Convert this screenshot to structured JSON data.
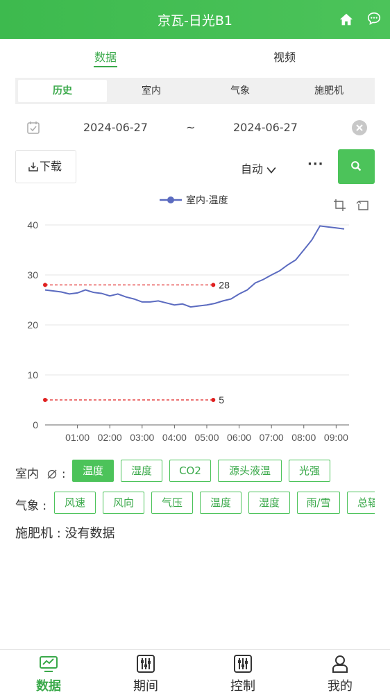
{
  "header": {
    "title": "京瓦-日光B1"
  },
  "top_tabs": [
    {
      "label": "数据",
      "active": true
    },
    {
      "label": "视频",
      "active": false
    }
  ],
  "sub_tabs": [
    {
      "label": "历史",
      "active": true
    },
    {
      "label": "室内"
    },
    {
      "label": "气象"
    },
    {
      "label": "施肥机"
    }
  ],
  "date_range": {
    "start": "2024-06-27",
    "separator": "~",
    "end": "2024-06-27"
  },
  "toolbar": {
    "download_label": "下载",
    "mode_label": "自动",
    "more_label": "···"
  },
  "chart_data": {
    "type": "line",
    "series": [
      {
        "name": "室内-温度",
        "color": "#5b6bc0"
      }
    ],
    "x_ticks": [
      "01:00",
      "02:00",
      "03:00",
      "04:00",
      "05:00",
      "06:00",
      "07:00",
      "08:00",
      "09:00"
    ],
    "y_ticks": [
      0,
      10,
      20,
      30,
      40
    ],
    "ylim": [
      0,
      40
    ],
    "xlim_hours": [
      0,
      9.4
    ],
    "x": [
      0.0,
      0.25,
      0.5,
      0.75,
      1.0,
      1.25,
      1.5,
      1.75,
      2.0,
      2.25,
      2.5,
      2.75,
      3.0,
      3.25,
      3.5,
      3.75,
      4.0,
      4.25,
      4.5,
      4.75,
      5.0,
      5.25,
      5.5,
      5.75,
      6.0,
      6.25,
      6.5,
      6.75,
      7.0,
      7.25,
      7.5,
      7.75,
      8.0,
      8.25,
      8.5,
      8.75,
      9.0,
      9.25
    ],
    "y": [
      27.0,
      26.8,
      26.6,
      26.2,
      26.4,
      27.0,
      26.5,
      26.3,
      25.8,
      26.2,
      25.6,
      25.2,
      24.6,
      24.6,
      24.8,
      24.4,
      24.0,
      24.2,
      23.6,
      23.8,
      24.0,
      24.3,
      24.8,
      25.2,
      26.2,
      27.0,
      28.4,
      29.1,
      30.0,
      30.8,
      32.0,
      33.0,
      35.0,
      37.0,
      39.8,
      39.6,
      39.4,
      39.2
    ],
    "reference_lines": [
      {
        "value": 28,
        "label": "28"
      },
      {
        "value": 5,
        "label": "5"
      }
    ]
  },
  "indoor_row": {
    "label": "室内",
    "chips": [
      {
        "label": "温度",
        "active": true
      },
      {
        "label": "湿度"
      },
      {
        "label": "CO2"
      },
      {
        "label": "源头液温"
      },
      {
        "label": "光强"
      }
    ]
  },
  "weather_row": {
    "label": "气象 :",
    "chips": [
      {
        "label": "风速"
      },
      {
        "label": "风向"
      },
      {
        "label": "气压"
      },
      {
        "label": "温度"
      },
      {
        "label": "湿度"
      },
      {
        "label": "雨/雪"
      },
      {
        "label": "总辐"
      }
    ]
  },
  "fertilizer": {
    "text": "施肥机 : 没有数据"
  },
  "tabbar": [
    {
      "label": "数据",
      "icon": "monitor-chart-icon",
      "active": true
    },
    {
      "label": "期间",
      "icon": "sliders-icon"
    },
    {
      "label": "控制",
      "icon": "sliders-icon"
    },
    {
      "label": "我的",
      "icon": "user-icon"
    }
  ],
  "colors": {
    "primary": "#4cc35a",
    "line": "#5b6bc0",
    "reference": "#e02020"
  }
}
